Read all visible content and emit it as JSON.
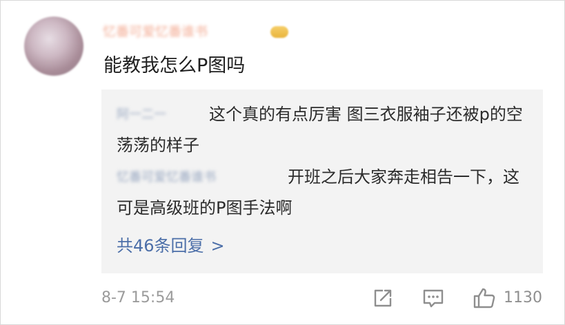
{
  "comment": {
    "username": "忆番可爱忆番谁书",
    "text": "能教我怎么P图吗",
    "timestamp": "8-7 15:54"
  },
  "replies": [
    {
      "author": "阿一二一",
      "text": "这个真的有点厉害 图三衣服袖子还被p的空荡荡的样子"
    },
    {
      "author": "忆番可爱忆番谁书",
      "text": "开班之后大家奔走相告一下，这可是高级班的P图手法啊"
    }
  ],
  "view_all_replies": "共46条回复",
  "view_all_chevron": ">",
  "actions": {
    "like_count": "1130"
  },
  "icons": {
    "share": "share-icon",
    "comment": "comment-icon",
    "like": "thumbs-up-icon"
  },
  "colors": {
    "reply_background": "#f3f3f3",
    "link": "#4b6ea8",
    "username": "#f2a48a",
    "meta_text": "#9b9b9b"
  }
}
